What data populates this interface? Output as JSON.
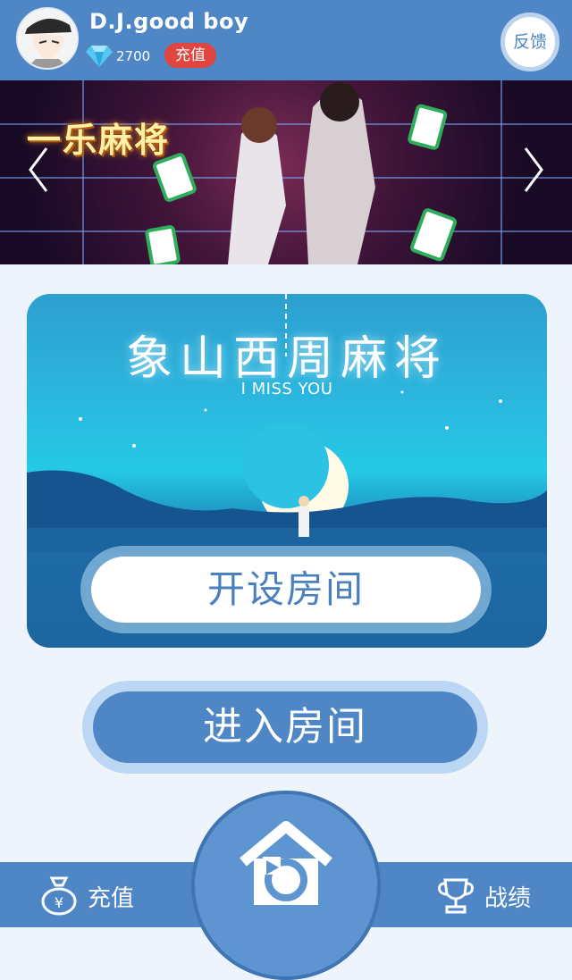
{
  "header": {
    "username": "D.J.good boy",
    "diamond_count": "2700",
    "recharge_label": "充值",
    "feedback_label": "反馈",
    "icons": {
      "avatar": "avatar-image",
      "diamond": "diamond-icon"
    }
  },
  "banner": {
    "logo_text": "一乐麻将",
    "icons": {
      "prev": "chevron-left-icon",
      "next": "chevron-right-icon"
    }
  },
  "game_card": {
    "title": "象山西周麻将",
    "subtitle": "I MISS YOU",
    "create_room_label": "开设房间"
  },
  "enter_room_label": "进入房间",
  "bottom_nav": {
    "recharge_label": "充值",
    "record_label": "战绩",
    "icons": {
      "recharge": "money-bag-icon",
      "home": "home-refresh-icon",
      "record": "trophy-icon"
    }
  },
  "colors": {
    "primary": "#4f86c6",
    "background": "#eef4fb",
    "badge_red": "#e0463f"
  }
}
